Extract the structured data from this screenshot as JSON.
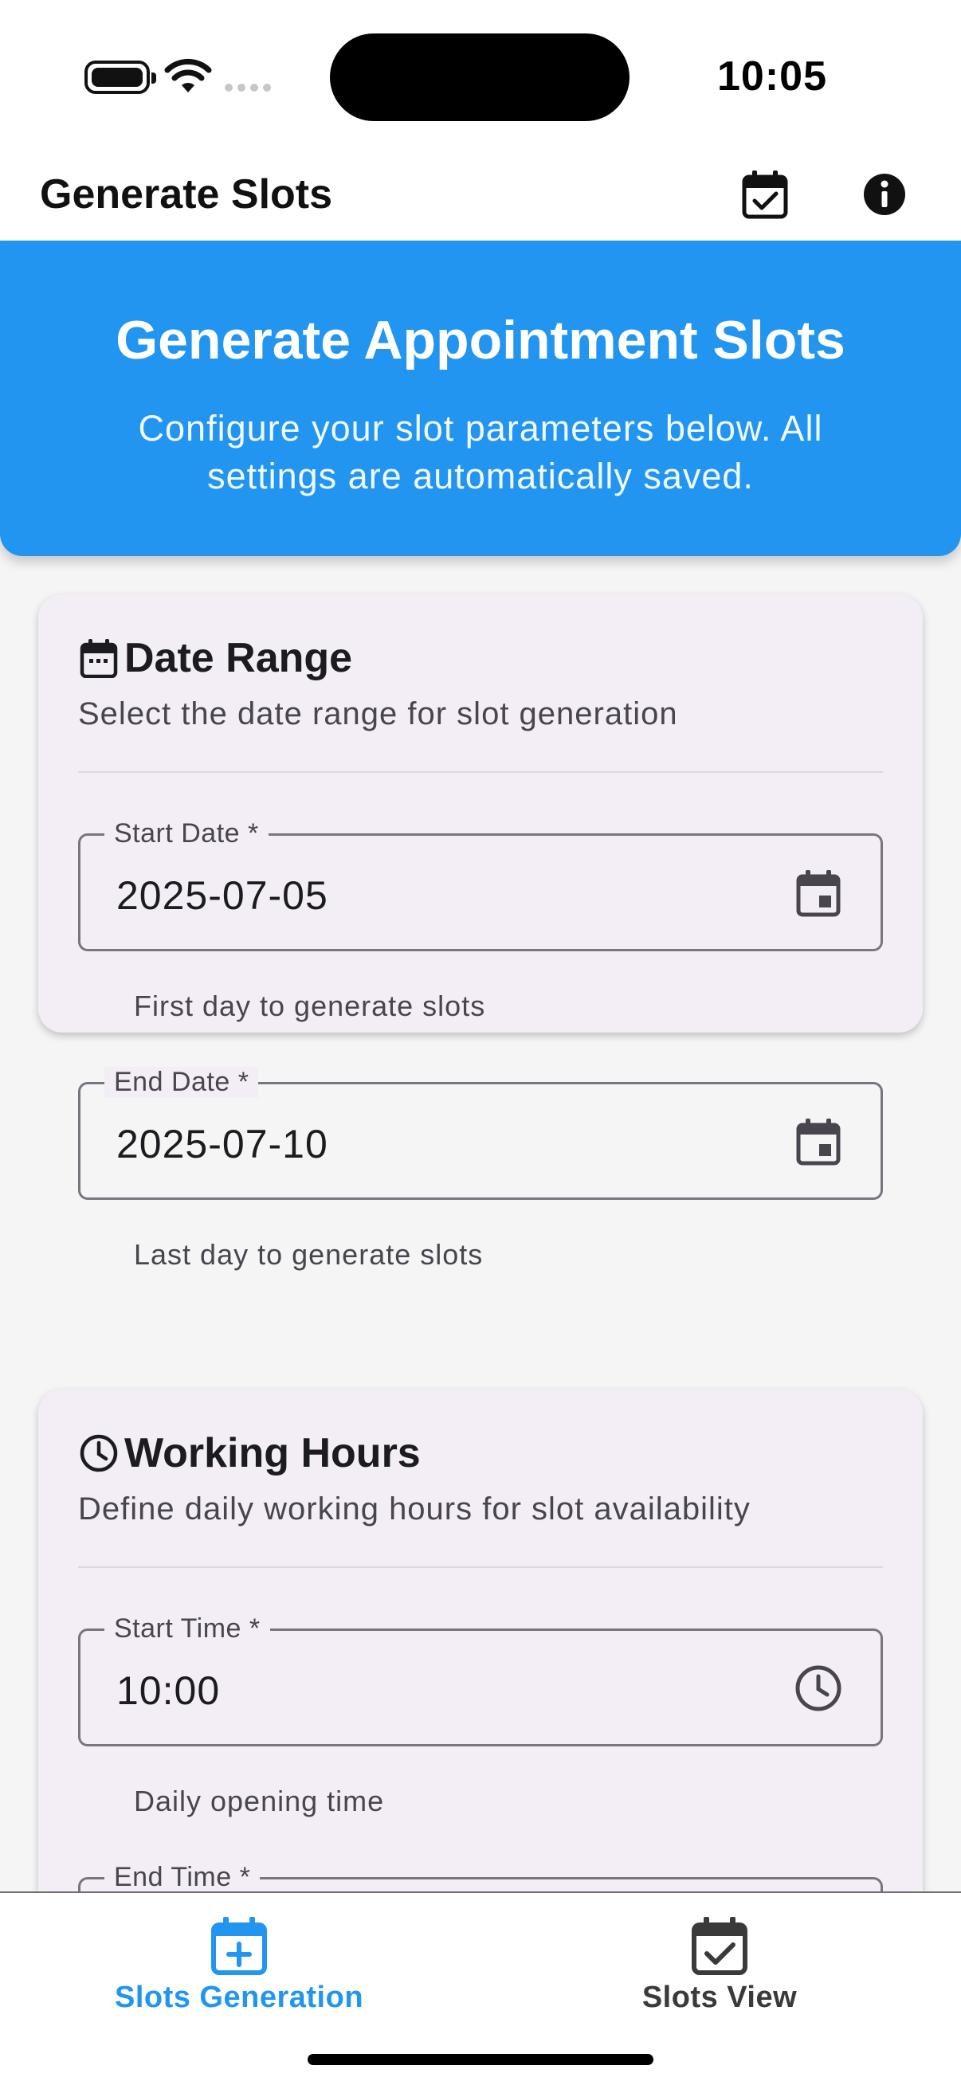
{
  "status_bar": {
    "time": "10:05"
  },
  "app_bar": {
    "title": "Generate Slots",
    "actions": [
      "calendar-check-icon",
      "info-icon"
    ]
  },
  "banner": {
    "title": "Generate Appointment Slots",
    "subtitle": "Configure your slot parameters below. All settings are automatically saved.",
    "color": "#2195F0"
  },
  "date_range": {
    "title": "Date Range",
    "description": "Select the date range for slot generation",
    "start": {
      "label": "Start Date *",
      "value": "2025-07-05",
      "helper": "First day to generate slots"
    },
    "end": {
      "label": "End Date *",
      "value": "2025-07-10",
      "helper": "Last day to generate slots"
    }
  },
  "working_hours": {
    "title": "Working Hours",
    "description": "Define daily working hours for slot availability",
    "start": {
      "label": "Start Time *",
      "value": "10:00",
      "helper": "Daily opening time"
    },
    "end": {
      "label": "End Time *"
    }
  },
  "bottom_nav": {
    "items": [
      {
        "label": "Slots Generation",
        "icon": "calendar-add-icon",
        "active": true
      },
      {
        "label": "Slots View",
        "icon": "calendar-check-icon",
        "active": false
      }
    ],
    "active_color": "#2195F0"
  }
}
